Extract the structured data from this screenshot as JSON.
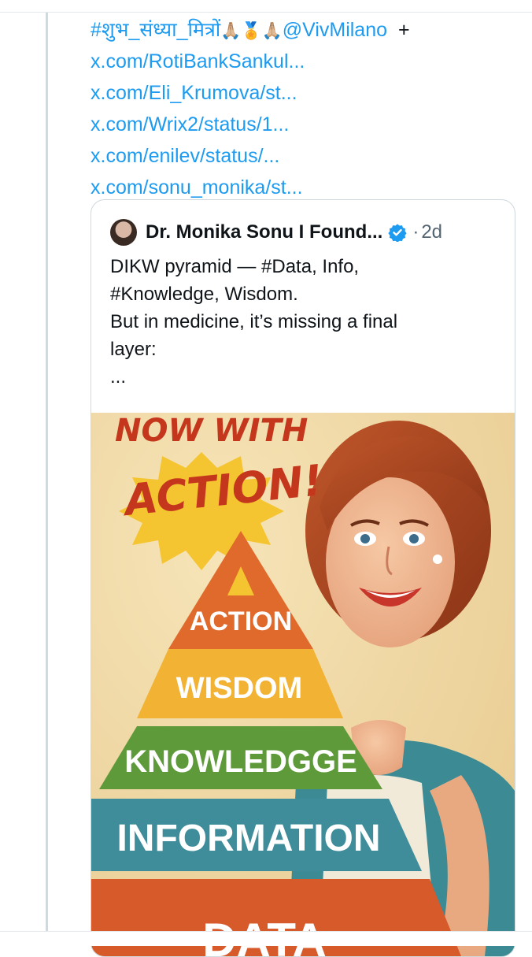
{
  "thread": {
    "hashtag_line": "#शुभ_संध्या_मित्रों",
    "hashtag_emoji": "🙏🏼🏅🙏🏼",
    "mention": "@VivMilano",
    "plus": "+",
    "links": [
      "x.com/RotiBankSankul...",
      "x.com/Eli_Krumova/st...",
      "x.com/Wrix2/status/1...",
      "x.com/enilev/status/...",
      "x.com/sonu_monika/st..."
    ]
  },
  "quote": {
    "author": "Dr. Monika Sonu I Found...",
    "separator": "·",
    "time": "2d",
    "text_lines": [
      "DIKW pyramid — #Data, Info,",
      "#Knowledge, Wisdom.",
      "But in medicine, it’s missing a final",
      "layer:",
      "..."
    ]
  },
  "image": {
    "headline_top": "NOW WITH",
    "headline_main": "ACTION!",
    "pyramid_levels": [
      "ACTION",
      "WISDOM",
      "KNOWLEDGGE",
      "INFORMATION",
      "DATA"
    ]
  },
  "colors": {
    "link": "#1d9bf0",
    "verified": "#1d9bf0",
    "text": "#0f1419",
    "muted": "#536471",
    "action": "#e06a2c",
    "wisdom": "#f2b233",
    "knowledge": "#5f9a3a",
    "information": "#3f8c9a",
    "data": "#d75a2a"
  }
}
